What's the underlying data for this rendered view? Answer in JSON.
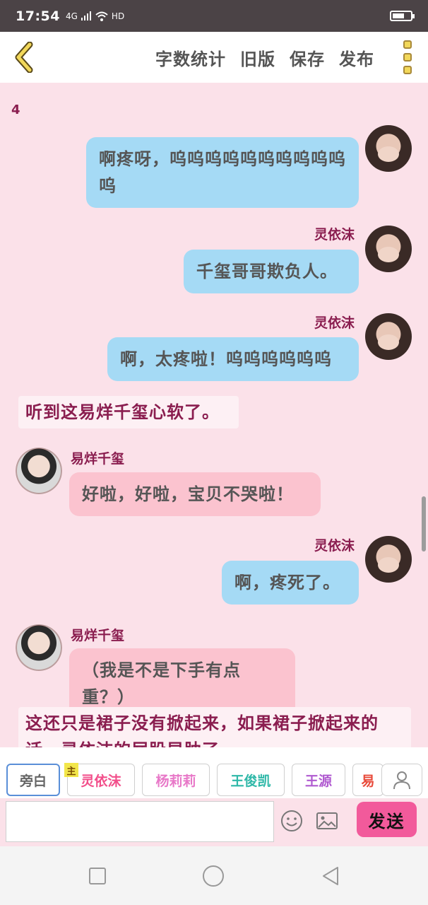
{
  "status_bar": {
    "time": "17:54",
    "network": "4G",
    "hd": "HD"
  },
  "toolbar": {
    "back_icon": "chevron-left-icon",
    "word_count": "字数统计",
    "old_version": "旧版",
    "save": "保存",
    "publish": "发布",
    "more_icon": "more-vertical-icon"
  },
  "chat": {
    "page_number": "4",
    "messages": [
      {
        "type": "right",
        "sender": "",
        "text": "啊疼呀，呜呜呜呜呜呜呜呜呜呜呜"
      },
      {
        "type": "right",
        "sender": "灵依沫",
        "text": "千玺哥哥欺负人。"
      },
      {
        "type": "right",
        "sender": "灵依沫",
        "text": "啊，太疼啦！呜呜呜呜呜呜"
      },
      {
        "type": "narration",
        "text": "听到这易烊千玺心软了。"
      },
      {
        "type": "left",
        "sender": "易烊千玺",
        "text": "好啦，好啦，宝贝不哭啦！"
      },
      {
        "type": "right",
        "sender": "灵依沫",
        "text": "啊，疼死了。"
      },
      {
        "type": "left",
        "sender": "易烊千玺",
        "text": "（我是不是下手有点重？）"
      },
      {
        "type": "narration",
        "text": "这还只是裙子没有掀起来，如果裙子掀起来的话，灵依沫的屁股早肿了。"
      }
    ]
  },
  "roles": {
    "main_tag": "主",
    "items": [
      {
        "label": "旁白",
        "color": "#666666"
      },
      {
        "label": "灵依沫",
        "color": "#f24e8a"
      },
      {
        "label": "杨莉莉",
        "color": "#e878c8"
      },
      {
        "label": "王俊凯",
        "color": "#2fb8a8"
      },
      {
        "label": "王源",
        "color": "#b05ad0"
      },
      {
        "label": "易",
        "color": "#e84a3a"
      }
    ],
    "person_icon": "person-icon"
  },
  "input_bar": {
    "placeholder": "",
    "emoji_icon": "emoji-icon",
    "image_icon": "image-icon",
    "send": "发送"
  },
  "nav": {
    "recents_icon": "square-icon",
    "home_icon": "circle-icon",
    "back_icon": "triangle-back-icon"
  },
  "colors": {
    "background": "#fbe1e9",
    "right_bubble": "#a5daf5",
    "left_bubble": "#fbc3cf",
    "name": "#8a1d4f",
    "send": "#f25a9b"
  }
}
